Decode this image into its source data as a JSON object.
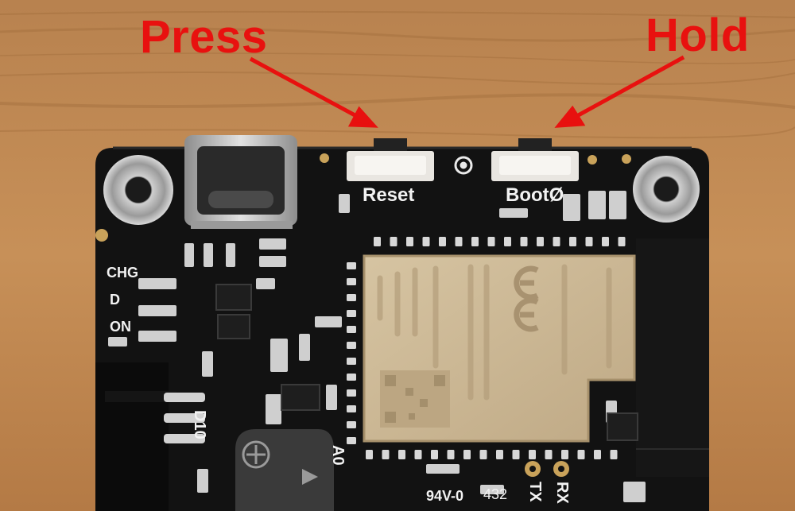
{
  "callouts": {
    "press": "Press",
    "hold": "Hold"
  },
  "silkscreen": {
    "reset": "Reset",
    "boot": "BootØ",
    "chg": "CHG",
    "d": "D",
    "on": "ON",
    "d10": "D10",
    "a0": "A0",
    "tx": "TX",
    "rx": "RX",
    "cert": "94V-0",
    "cert_code": "432"
  },
  "colors": {
    "annotation": "#e8110f",
    "wood": "#c28850",
    "pcb": "#121212",
    "module_shield": "#cdb994",
    "silkscreen": "#f2f2f2",
    "pad_gold": "#c9a25a"
  },
  "icons": [
    "usb-c-port",
    "tactile-button",
    "mounting-hole",
    "buzzer",
    "rf-shield-module",
    "ce-mark"
  ]
}
